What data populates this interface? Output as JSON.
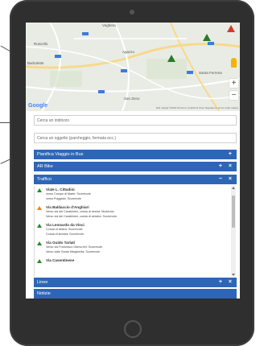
{
  "map": {
    "labels": {
      "top": "Voghera",
      "ruscello": "Ruscello",
      "barbolette": "Barbolette",
      "agazzo": "Agazzo",
      "santa_ferrena": "Santa Ferrena",
      "san_zeno": "San Zeno"
    },
    "google": "Google",
    "attribution": "Dati mappa ©2019   Termini e condizioni d'uso   Segnala un errore nella mappa",
    "zoom_in": "+",
    "zoom_out": "−"
  },
  "search": {
    "address_placeholder": "Cerca un indirizzo",
    "object_placeholder": "Cerca un oggetto (parcheggio, fermata ecc.)"
  },
  "panels": {
    "trip": {
      "title": "Pianifica Viaggio in Bus",
      "plus": "+"
    },
    "ar_bike": {
      "title": "AR Bike",
      "plus": "+",
      "close": "×"
    },
    "traffic": {
      "title": "Traffico",
      "minus": "−",
      "close": "×"
    },
    "lines": {
      "title": "Linee",
      "plus": "+",
      "close": "×"
    },
    "news": {
      "title": "Notizie"
    }
  },
  "traffic": {
    "items": [
      {
        "title": "Viale L. Cittadini",
        "lines": [
          "verso Campo di Marte: Scorrevole",
          "verso Poggiola: Scorrevole"
        ],
        "level": "green"
      },
      {
        "title": "Via Baldaccio d'Anghiari",
        "lines": [
          "Verso via dei Carabinieri, corsia di destra: Moderato",
          "Verso via dei Carabinieri, corsia di sinistra: Scorrevole"
        ],
        "level": "orange"
      },
      {
        "title": "Via Leonardo da Vinci",
        "lines": [
          "Corsia di destra: Scorrevole",
          "Corsia di sinistra: Scorrevole"
        ],
        "level": "green"
      },
      {
        "title": "Via Guido Tarlati",
        "lines": [
          "Verso via Francesco Gamurrini: Scorrevole",
          "Verso viale Santa Margherita: Scorrevole"
        ],
        "level": "green"
      },
      {
        "title": "Via Casentinese",
        "lines": [],
        "level": "green"
      }
    ]
  },
  "colors": {
    "panel": "#2e66b7",
    "good": "#2a8a2a",
    "moderate": "#e08a1e"
  }
}
